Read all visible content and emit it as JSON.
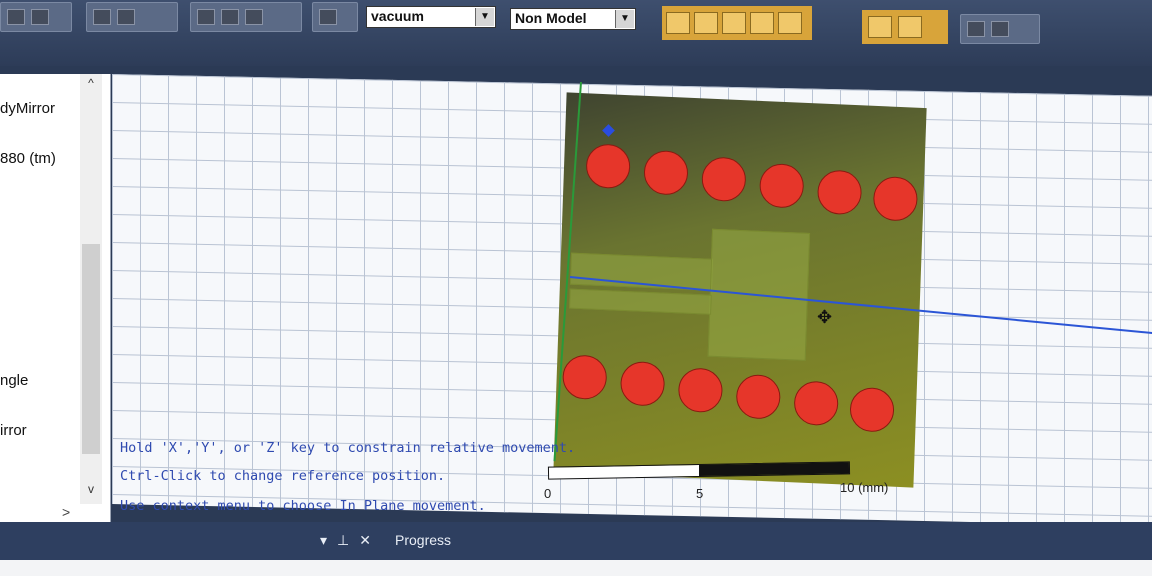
{
  "toolbar": {
    "background_combo": "vacuum",
    "model_combo": "Non Model"
  },
  "left_panel": {
    "items": [
      "dyMirror",
      "880 (tm)",
      "ngle",
      "irror"
    ]
  },
  "viewport": {
    "hints": [
      "Hold 'X','Y', or 'Z' key to constrain relative movement.",
      "Ctrl-Click to change reference position.",
      "Use context menu to choose In Plane movement."
    ],
    "scale": {
      "labels": [
        "0",
        "5",
        "10 (mm)"
      ]
    }
  },
  "bottom_panel": {
    "tab_label": "Progress",
    "pane_icons": [
      "▾",
      "⊥",
      "✕"
    ]
  },
  "colors": {
    "board": "#7d7f2a",
    "hole": "#e6362a",
    "axis_blue": "#2b55d6",
    "axis_green": "#2a9a3a"
  }
}
